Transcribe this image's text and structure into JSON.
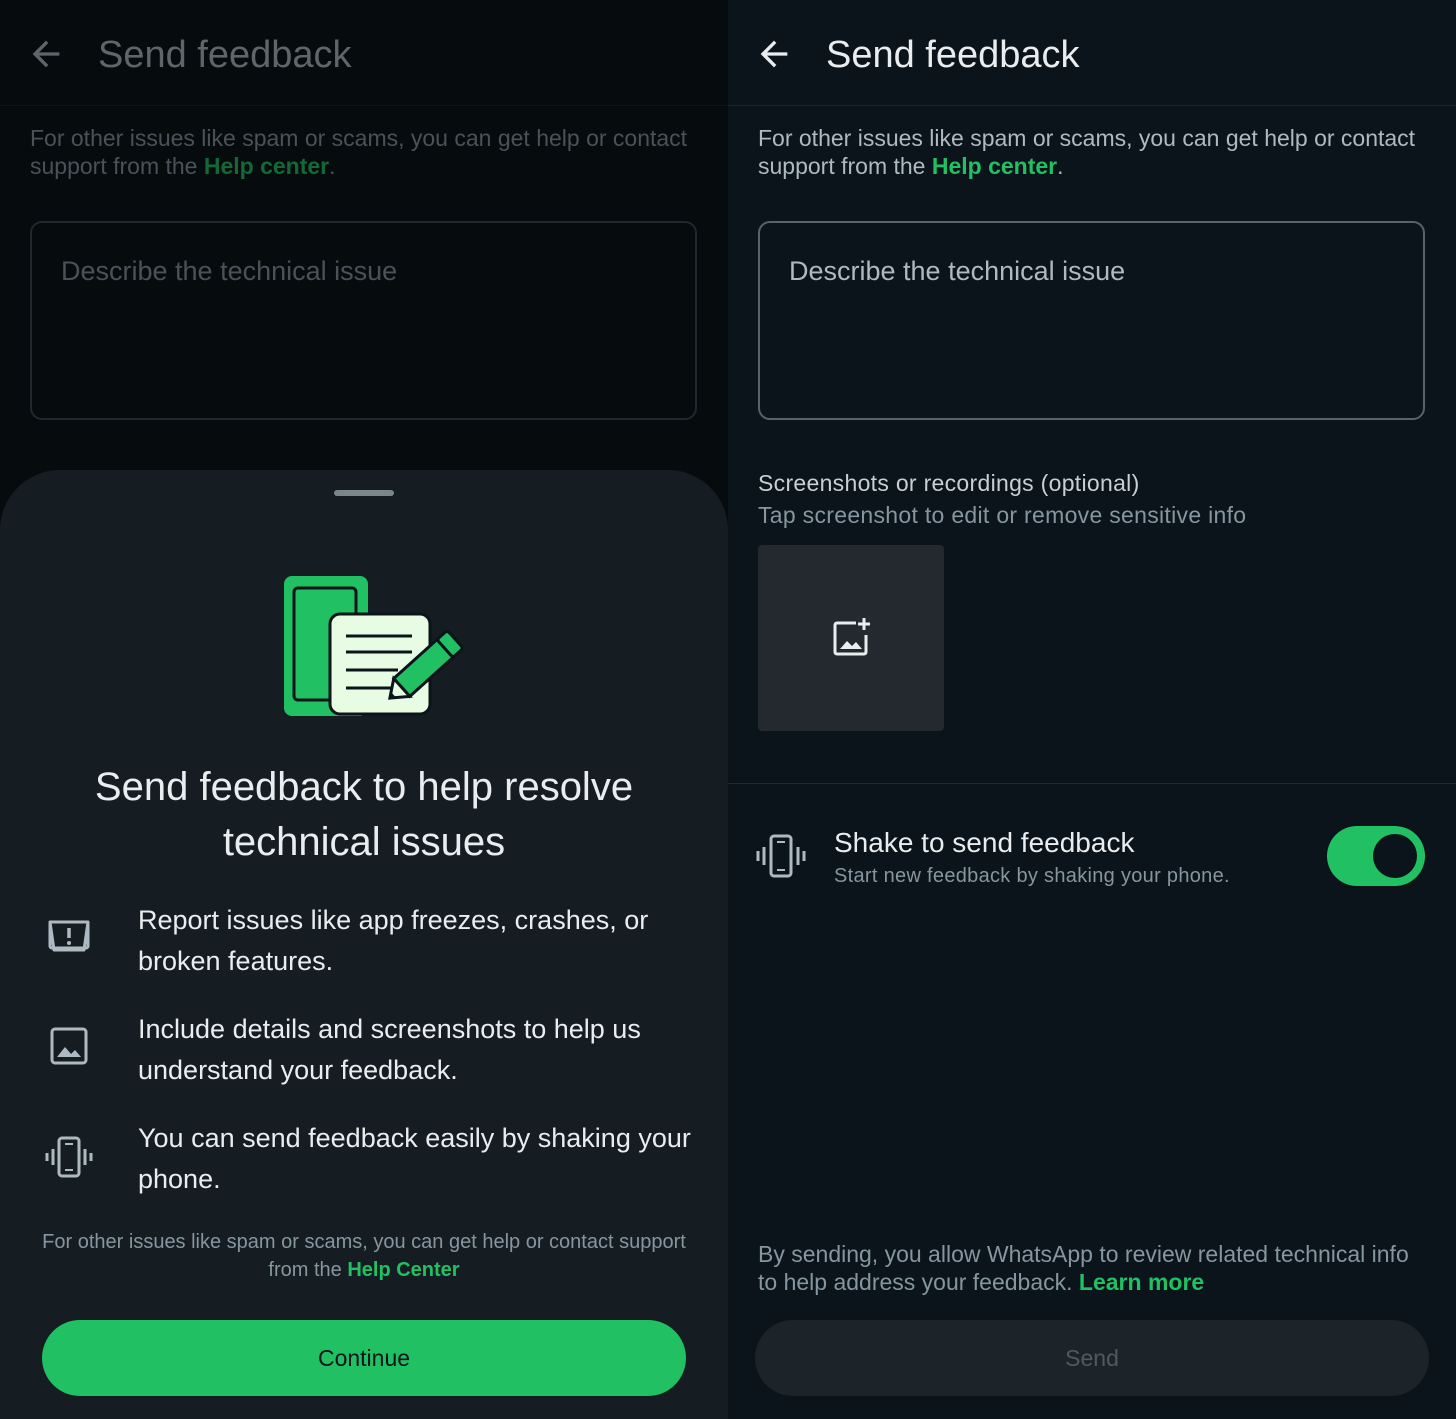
{
  "left": {
    "header": {
      "title": "Send feedback"
    },
    "help": {
      "text_before": "For other issues like spam or scams, you can get help or contact support from the ",
      "link": "Help center",
      "text_after": "."
    },
    "description_input": {
      "placeholder": "Describe the technical issue"
    },
    "sheet": {
      "title": "Send feedback to help resolve technical issues",
      "features": [
        {
          "icon": "report-issue-icon",
          "text": "Report issues like app freezes, crashes, or broken features."
        },
        {
          "icon": "image-icon",
          "text": "Include details and screenshots to help us understand your feedback."
        },
        {
          "icon": "phone-vibrate-icon",
          "text": "You can send feedback easily by shaking your phone."
        }
      ],
      "footer": {
        "text_before": "For other issues like spam or scams, you can get help or contact support from the ",
        "link": "Help Center"
      },
      "continue_label": "Continue"
    }
  },
  "right": {
    "header": {
      "title": "Send feedback"
    },
    "help": {
      "text_before": "For other issues like spam or scams, you can get help or contact support from the ",
      "link": "Help center",
      "text_after": "."
    },
    "description_input": {
      "placeholder": "Describe the technical issue"
    },
    "screenshots": {
      "label": "Screenshots or recordings (optional)",
      "sublabel": "Tap screenshot to edit or remove sensitive info"
    },
    "shake": {
      "title": "Shake to send feedback",
      "subtitle": "Start new feedback by shaking your phone.",
      "enabled": true
    },
    "consent": {
      "text": "By sending, you allow WhatsApp to review related technical info to help address your feedback. ",
      "link": "Learn more"
    },
    "send_label": "Send"
  },
  "colors": {
    "accent": "#21c063",
    "background": "#0b141a",
    "sheet": "#161d22",
    "muted_text": "#8696a0"
  }
}
